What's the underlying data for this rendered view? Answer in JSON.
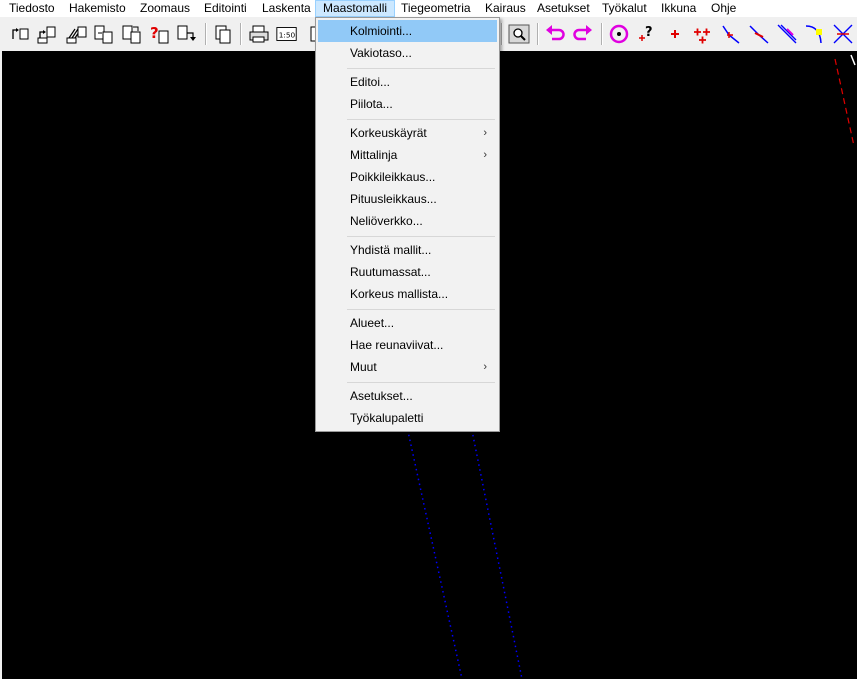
{
  "menubar": {
    "items": [
      "Tiedosto",
      "Hakemisto",
      "Zoomaus",
      "Editointi",
      "Laskenta",
      "Maastomalli",
      "Tiegeometria",
      "Kairaus",
      "Asetukset",
      "Työkalut",
      "Ikkuna",
      "Ohje"
    ],
    "active_index": 5
  },
  "toolbar": {
    "icons": [
      "open-profile-icon",
      "save-profile-icon",
      "hatch-profile-icon",
      "export-document-icon",
      "import-document-icon",
      "help-query-icon",
      "document-arrow-icon",
      "copy-icon",
      "print-icon",
      "scale-150-icon",
      "zoom-icon",
      "undo-icon",
      "redo-icon",
      "target-icon",
      "point-query-icon",
      "add-point-icon",
      "add-points-icon",
      "line-tool-icon",
      "polyline-tool-icon",
      "alignment-tool-icon",
      "curve-tool-icon",
      "cross-tool-icon"
    ],
    "scale_label": "1:50",
    "colors": {
      "accent": "#e000e0",
      "red": "#e00000",
      "blue": "#0000ff"
    }
  },
  "dropdown": {
    "groups": [
      [
        {
          "label": "Kolmiointi...",
          "highlighted": true
        },
        {
          "label": "Vakiotaso..."
        }
      ],
      [
        {
          "label": "Editoi..."
        },
        {
          "label": "Piilota..."
        }
      ],
      [
        {
          "label": "Korkeuskäyrät",
          "submenu": true
        },
        {
          "label": "Mittalinja",
          "submenu": true
        },
        {
          "label": "Poikkileikkaus..."
        },
        {
          "label": "Pituusleikkaus..."
        },
        {
          "label": "Neliöverkko..."
        }
      ],
      [
        {
          "label": "Yhdistä mallit..."
        },
        {
          "label": "Ruutumassat..."
        },
        {
          "label": "Korkeus mallista..."
        }
      ],
      [
        {
          "label": "Alueet..."
        },
        {
          "label": "Hae reunaviivat..."
        },
        {
          "label": "Muut",
          "submenu": true
        }
      ],
      [
        {
          "label": "Asetukset..."
        },
        {
          "label": "Työkalupaletti"
        }
      ]
    ],
    "submenu_glyph": "›"
  },
  "canvas": {
    "background": "#000000",
    "line_colors": [
      "#0000ff",
      "#ff0000",
      "#ffffff"
    ]
  }
}
